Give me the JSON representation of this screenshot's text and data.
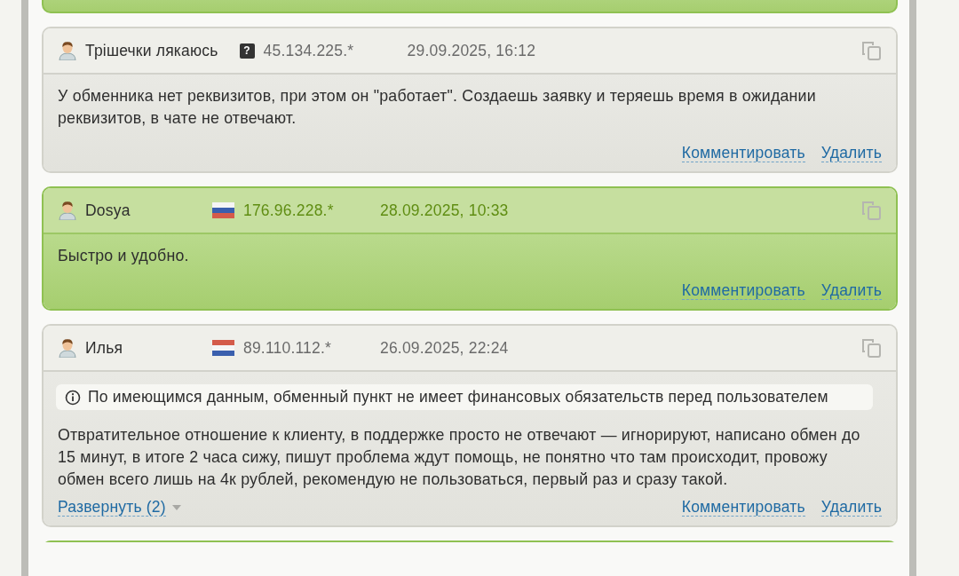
{
  "top_cut_card": {
    "kind": "positive"
  },
  "reviews": [
    {
      "kind": "neutral",
      "author": "Трішечки лякаюсь",
      "origin": {
        "kind": "unknown",
        "mark": "?"
      },
      "ip": "45.134.225.*",
      "date": "29.09.2025, 16:12",
      "text": "У обменника нет реквизитов, при этом он \"работает\". Создаешь заявку и теряешь время в ожидании реквизитов, в чате не отвечают.",
      "actions": [
        "Комментировать",
        "Удалить"
      ]
    },
    {
      "kind": "positive",
      "author": "Dosya",
      "origin": {
        "kind": "ru"
      },
      "ip": "176.96.228.*",
      "date": "28.09.2025, 10:33",
      "text": "Быстро и удобно.",
      "actions": [
        "Комментировать",
        "Удалить"
      ]
    },
    {
      "kind": "neutral",
      "author": "Илья",
      "origin": {
        "kind": "nl"
      },
      "ip": "89.110.112.*",
      "date": "26.09.2025, 22:24",
      "notice": "По имеющимся данным, обменный пункт не имеет финансовых обязательств перед пользователем",
      "text": "Отвратительное отношение к клиенту, в поддержке просто не отвечают — игнорируют, написано обмен до 15 минут, в итоге 2 часа сижу, пишут проблема ждут помощь, не понятно что там происходит, провожу обмен всего лишь на 4к рублей, рекомендую не пользоваться, первый раз и сразу такой.",
      "expand": {
        "label": "Развернуть (2)",
        "expanded": false
      },
      "actions": [
        "Комментировать",
        "Удалить"
      ]
    }
  ],
  "bottom_cut_card": {
    "kind": "positive"
  }
}
